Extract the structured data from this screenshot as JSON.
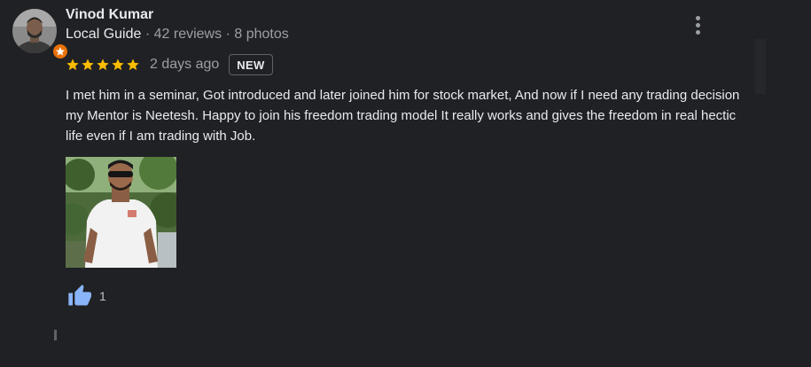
{
  "review": {
    "author": "Vinod Kumar",
    "guide_label": "Local Guide",
    "separator": "·",
    "reviews_count": "42 reviews",
    "photos_count": "8 photos",
    "rating": 5,
    "time_ago": "2 days ago",
    "badge": "NEW",
    "text": "I met him in a seminar, Got introduced and later joined him for stock market, And now if I need any trading decision my Mentor is Neetesh. Happy to join his freedom trading model It really works and gives the freedom in real hectic life even if I am trading with Job.",
    "likes": "1"
  },
  "colors": {
    "background": "#202124",
    "star": "#fbbc04",
    "like_icon": "#8ab4f8",
    "guide_badge": "#e8710a"
  },
  "icons": {
    "menu": "more-vert-icon",
    "like": "thumb-up-icon",
    "guide": "local-guide-star-icon"
  }
}
